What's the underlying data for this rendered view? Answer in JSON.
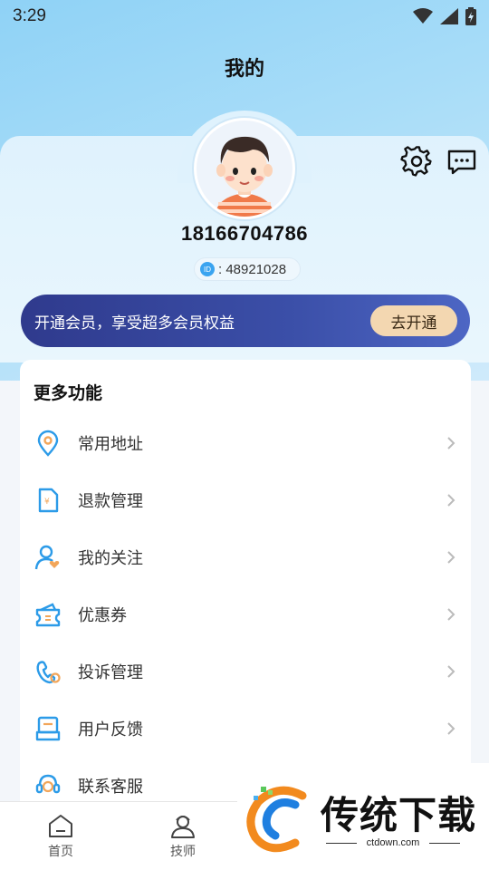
{
  "status": {
    "time": "3:29"
  },
  "header": {
    "title": "我的"
  },
  "profile": {
    "phone": "18166704786",
    "id_badge": "ID",
    "id_label": ":  48921028"
  },
  "vip": {
    "text": "开通会员，享受超多会员权益",
    "button": "去开通"
  },
  "more": {
    "title": "更多功能",
    "items": [
      {
        "label": "常用地址",
        "icon": "location-icon"
      },
      {
        "label": "退款管理",
        "icon": "refund-icon"
      },
      {
        "label": "我的关注",
        "icon": "follow-icon"
      },
      {
        "label": "优惠券",
        "icon": "coupon-icon"
      },
      {
        "label": "投诉管理",
        "icon": "complaint-icon"
      },
      {
        "label": "用户反馈",
        "icon": "feedback-icon"
      },
      {
        "label": "联系客服",
        "icon": "customer-service-icon"
      }
    ]
  },
  "nav": {
    "home": "首页",
    "technician": "技师"
  },
  "watermark": {
    "title": "传统下载",
    "url": "ctdown.com"
  },
  "colors": {
    "accent": "#3aa4f0",
    "vip_bg": "#2f3a8d",
    "vip_button": "#f3d7b1"
  }
}
